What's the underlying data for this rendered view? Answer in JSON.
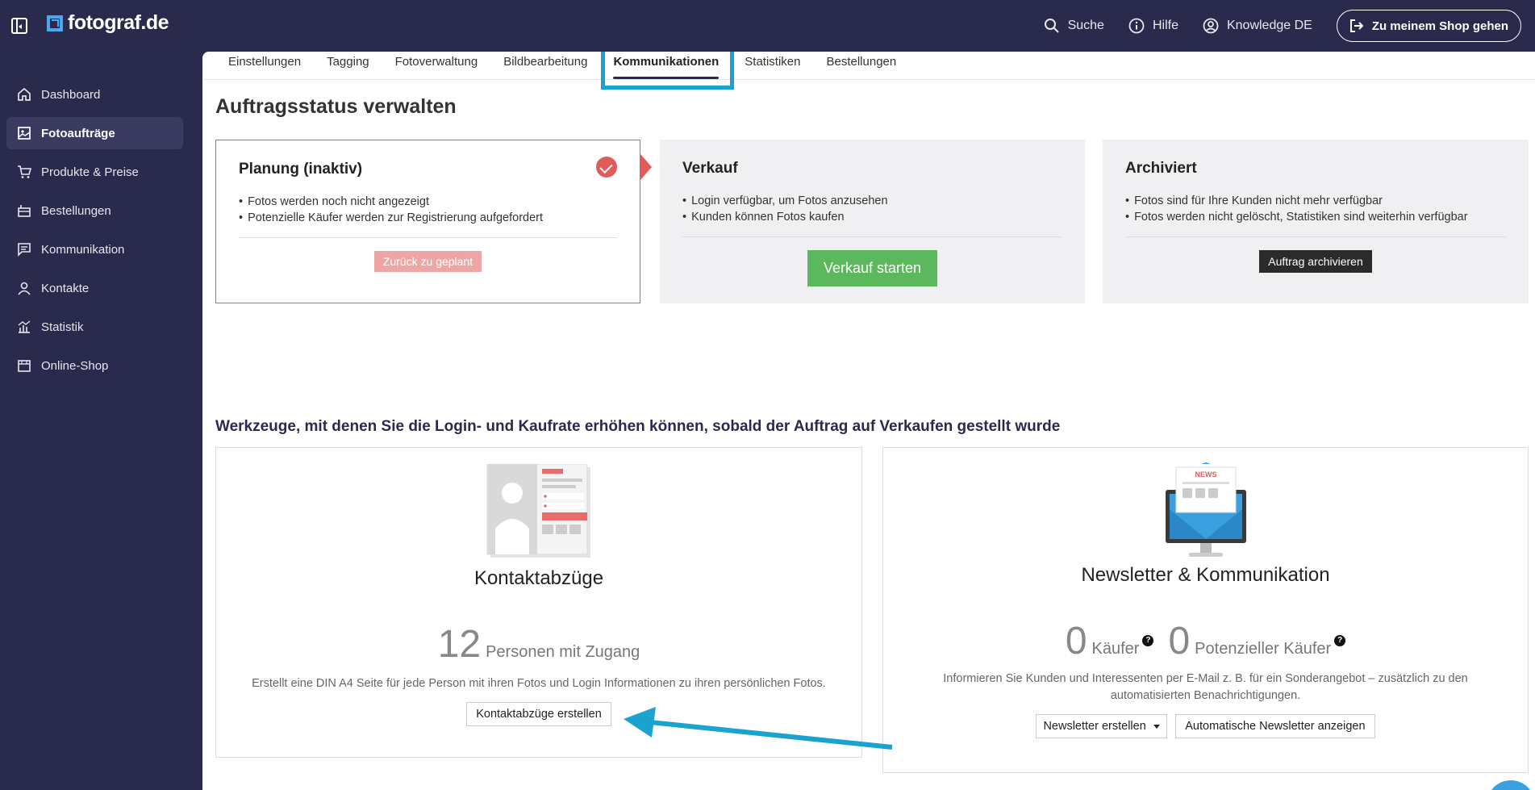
{
  "app": {
    "logo_text": "fotograf.de"
  },
  "topbar": {
    "search_label": "Suche",
    "help_label": "Hilfe",
    "account_label": "Knowledge DE",
    "shop_button_label": "Zu meinem Shop gehen"
  },
  "sidebar": {
    "items": [
      {
        "label": "Dashboard",
        "icon": "home-icon"
      },
      {
        "label": "Fotoaufträge",
        "icon": "image-icon"
      },
      {
        "label": "Produkte & Preise",
        "icon": "cart-icon"
      },
      {
        "label": "Bestellungen",
        "icon": "orders-icon"
      },
      {
        "label": "Kommunikation",
        "icon": "message-icon"
      },
      {
        "label": "Kontakte",
        "icon": "person-icon"
      },
      {
        "label": "Statistik",
        "icon": "chart-icon"
      },
      {
        "label": "Online-Shop",
        "icon": "store-icon"
      }
    ],
    "active_index": 1
  },
  "tabs": {
    "items": [
      "Einstellungen",
      "Tagging",
      "Fotoverwaltung",
      "Bildbearbeitung",
      "Kommunikationen",
      "Statistiken",
      "Bestellungen"
    ],
    "active_index": 4
  },
  "page": {
    "title": "Auftragsstatus verwalten",
    "section_title": "Werkzeuge, mit denen Sie die Login- und Kaufrate erhöhen können, sobald der Auftrag auf Verkaufen gestellt wurde"
  },
  "status": {
    "planning": {
      "title": "Planung (inaktiv)",
      "bullets": [
        "Fotos werden noch nicht angezeigt",
        "Potenzielle Käufer werden zur Registrierung aufgefordert"
      ],
      "button": "Zurück zu geplant"
    },
    "sale": {
      "title": "Verkauf",
      "bullets": [
        "Login verfügbar, um Fotos anzusehen",
        "Kunden können Fotos kaufen"
      ],
      "button": "Verkauf starten"
    },
    "archived": {
      "title": "Archiviert",
      "bullets": [
        "Fotos sind für Ihre Kunden nicht mehr verfügbar",
        "Fotos werden nicht gelöscht, Statistiken sind weiterhin verfügbar"
      ],
      "button": "Auftrag archivieren"
    }
  },
  "tools": {
    "contact_sheets": {
      "title": "Kontaktabzüge",
      "count": "12",
      "count_label": "Personen mit Zugang",
      "description": "Erstellt eine DIN A4 Seite für jede Person mit ihren Fotos und Login Informationen zu ihren persönlichen Fotos.",
      "button": "Kontaktabzüge erstellen"
    },
    "newsletter": {
      "title": "Newsletter & Kommunikation",
      "buyers_count": "0",
      "buyers_label": "Käufer",
      "potential_count": "0",
      "potential_label": "Potenzieller Käufer",
      "help_glyph": "?",
      "description_line1": "Informieren Sie Kunden und Interessenten per E-Mail z. B. für ein Sonderangebot – zusätzlich zu den",
      "description_line2": "automatisierten Benachrichtigungen.",
      "news_badge": "NEWS",
      "create_button": "Newsletter erstellen",
      "auto_button": "Automatische Newsletter anzeigen"
    }
  },
  "colors": {
    "sidebar_bg": "#2a2a4d",
    "accent_red": "#e05b5b",
    "success_green": "#5cb85c",
    "highlight_blue": "#1aa3cf"
  }
}
